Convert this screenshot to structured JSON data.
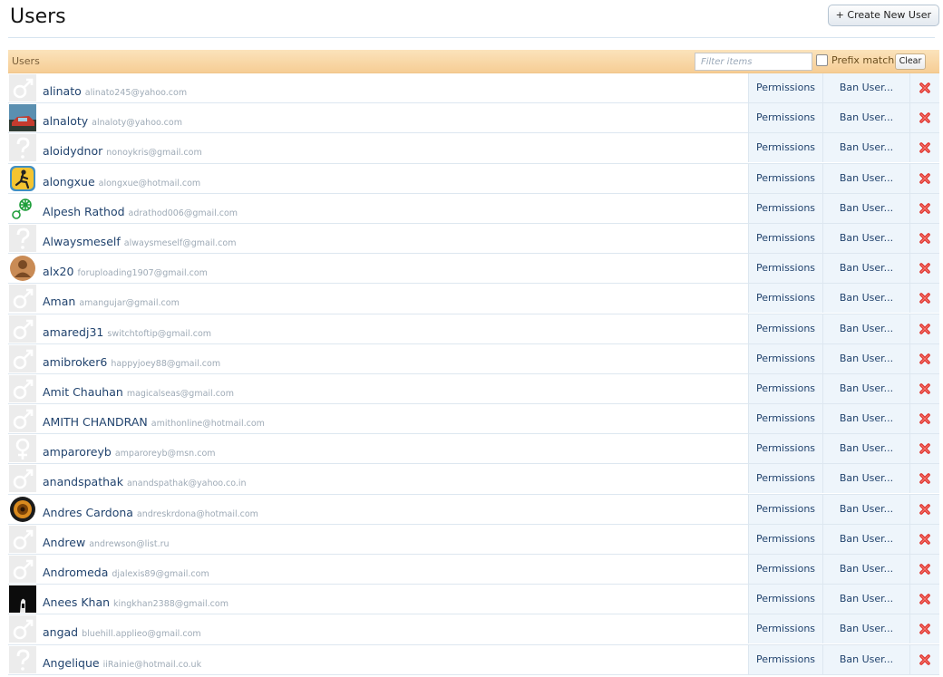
{
  "page": {
    "title": "Users",
    "create_button": "+ Create New User"
  },
  "list": {
    "header_title": "Users",
    "filter_placeholder": "Filter items",
    "prefix_label": "Prefix match",
    "clear_label": "Clear"
  },
  "colors": {
    "accent": "#21436e",
    "header_bar": "#f6cd95",
    "delete": "#e0312c"
  },
  "users": [
    {
      "name": "alinato",
      "email": "alinato245@yahoo.com",
      "avatar": "male-icon",
      "permissions": "Permissions",
      "ban": "Ban User..."
    },
    {
      "name": "alnaloty",
      "email": "alnaloty@yahoo.com",
      "avatar": "photo-car",
      "permissions": "Permissions",
      "ban": "Ban User..."
    },
    {
      "name": "aloidydnor",
      "email": "nonoykris@gmail.com",
      "avatar": "unknown-icon",
      "permissions": "Permissions",
      "ban": "Ban User..."
    },
    {
      "name": "alongxue",
      "email": "alongxue@hotmail.com",
      "avatar": "aim-runner",
      "permissions": "Permissions",
      "ban": "Ban User..."
    },
    {
      "name": "Alpesh Rathod",
      "email": "adrathod006@gmail.com",
      "avatar": "molecule",
      "permissions": "Permissions",
      "ban": "Ban User..."
    },
    {
      "name": "Alwaysmeself",
      "email": "alwaysmeself@gmail.com",
      "avatar": "unknown-icon",
      "permissions": "Permissions",
      "ban": "Ban User..."
    },
    {
      "name": "alx20",
      "email": "foruploading1907@gmail.com",
      "avatar": "brown-person",
      "permissions": "Permissions",
      "ban": "Ban User..."
    },
    {
      "name": "Aman",
      "email": "amangujar@gmail.com",
      "avatar": "male-icon",
      "permissions": "Permissions",
      "ban": "Ban User..."
    },
    {
      "name": "amaredj31",
      "email": "switchtoftip@gmail.com",
      "avatar": "male-icon",
      "permissions": "Permissions",
      "ban": "Ban User..."
    },
    {
      "name": "amibroker6",
      "email": "happyjoey88@gmail.com",
      "avatar": "male-icon",
      "permissions": "Permissions",
      "ban": "Ban User..."
    },
    {
      "name": "Amit Chauhan",
      "email": "magicalseas@gmail.com",
      "avatar": "male-icon",
      "permissions": "Permissions",
      "ban": "Ban User..."
    },
    {
      "name": "AMITH CHANDRAN",
      "email": "amithonline@hotmail.com",
      "avatar": "male-icon",
      "permissions": "Permissions",
      "ban": "Ban User..."
    },
    {
      "name": "amparoreyb",
      "email": "amparoreyb@msn.com",
      "avatar": "female-icon",
      "permissions": "Permissions",
      "ban": "Ban User..."
    },
    {
      "name": "anandspathak",
      "email": "anandspathak@yahoo.co.in",
      "avatar": "male-icon",
      "permissions": "Permissions",
      "ban": "Ban User..."
    },
    {
      "name": "Andres Cardona",
      "email": "andreskrdona@hotmail.com",
      "avatar": "speaker",
      "permissions": "Permissions",
      "ban": "Ban User..."
    },
    {
      "name": "Andrew",
      "email": "andrewson@list.ru",
      "avatar": "male-icon",
      "permissions": "Permissions",
      "ban": "Ban User..."
    },
    {
      "name": "Andromeda",
      "email": "djalexis89@gmail.com",
      "avatar": "male-icon",
      "permissions": "Permissions",
      "ban": "Ban User..."
    },
    {
      "name": "Anees Khan",
      "email": "kingkhan2388@gmail.com",
      "avatar": "dark-photo",
      "permissions": "Permissions",
      "ban": "Ban User..."
    },
    {
      "name": "angad",
      "email": "bluehill.applieo@gmail.com",
      "avatar": "male-icon",
      "permissions": "Permissions",
      "ban": "Ban User..."
    },
    {
      "name": "Angelique",
      "email": "iiRainie@hotmail.co.uk",
      "avatar": "unknown-icon",
      "permissions": "Permissions",
      "ban": "Ban User..."
    }
  ]
}
